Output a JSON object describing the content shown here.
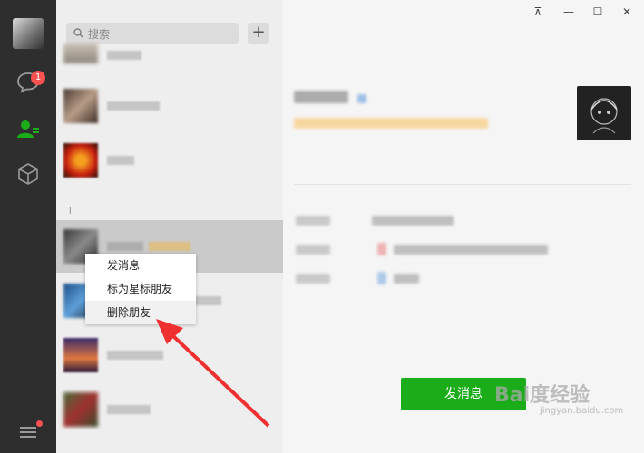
{
  "rail": {
    "chat_badge": "1"
  },
  "search": {
    "placeholder": "搜索"
  },
  "contacts": {
    "section_letter": "T"
  },
  "context_menu": {
    "items": [
      "发消息",
      "标为星标朋友",
      "删除朋友"
    ]
  },
  "profile": {
    "send_message_label": "发消息"
  },
  "window": {
    "pin_label": "⊼",
    "minimize_label": "—",
    "maximize_label": "☐",
    "close_label": "✕"
  },
  "watermark": {
    "text": "Bai度经验",
    "sub": "jingyan.baidu.com"
  },
  "colors": {
    "rail": "#2e2e2e",
    "accent_green": "#1aad19",
    "badge_red": "#fa5151",
    "arrow_red": "#f03030"
  }
}
